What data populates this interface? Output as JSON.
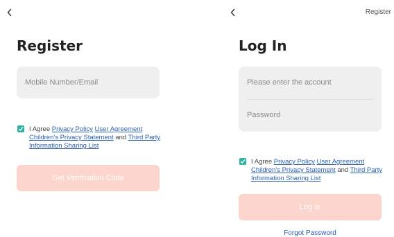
{
  "register_screen": {
    "title": "Register",
    "input_placeholder": "Mobile Number/Email",
    "agreement": {
      "prefix": "I Agree",
      "privacy_policy": "Privacy Policy",
      "user_agreement": "User Agreement",
      "childrens_privacy": "Children's Privacy Statement",
      "and": "and",
      "third_party": "Third Party Information Sharing List"
    },
    "button_label": "Get Verification Code"
  },
  "login_screen": {
    "title": "Log In",
    "register_link": "Register",
    "account_placeholder": "Please enter the account",
    "password_placeholder": "Password",
    "agreement": {
      "prefix": "I Agree",
      "privacy_policy": "Privacy Policy",
      "user_agreement": "User Agreement",
      "childrens_privacy": "Children's Privacy Statement",
      "and": "and",
      "third_party": "Third Party Information Sharing List"
    },
    "button_label": "Log In",
    "forgot_password": "Forgot Password"
  },
  "colors": {
    "accent_button": "#fcd5cc",
    "checkbox": "#2bb3a6",
    "link": "#2a5fb0",
    "field_bg": "#efefef"
  },
  "icons": {
    "back": "chevron-left-icon",
    "check": "check-icon"
  }
}
